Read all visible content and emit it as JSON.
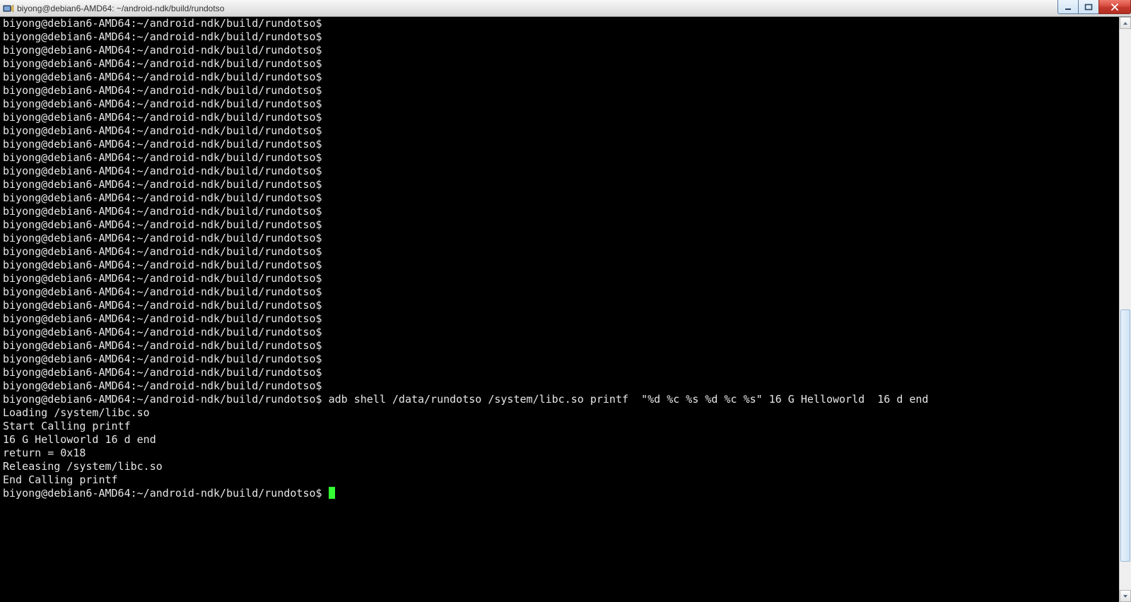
{
  "window": {
    "title": "biyong@debian6-AMD64: ~/android-ndk/build/rundotso"
  },
  "terminal": {
    "prompt": "biyong@debian6-AMD64:~/android-ndk/build/rundotso$",
    "empty_prompt_count": 28,
    "command": "adb shell /data/rundotso /system/libc.so printf  \"%d %c %s %d %c %s\" 16 G Helloworld  16 d end",
    "output_lines": [
      "Loading /system/libc.so",
      "Start Calling printf",
      "",
      "",
      "16 G Helloworld 16 d end",
      "",
      "return = 0x18",
      "",
      "",
      "Releasing /system/libc.so",
      "End Calling printf"
    ]
  }
}
